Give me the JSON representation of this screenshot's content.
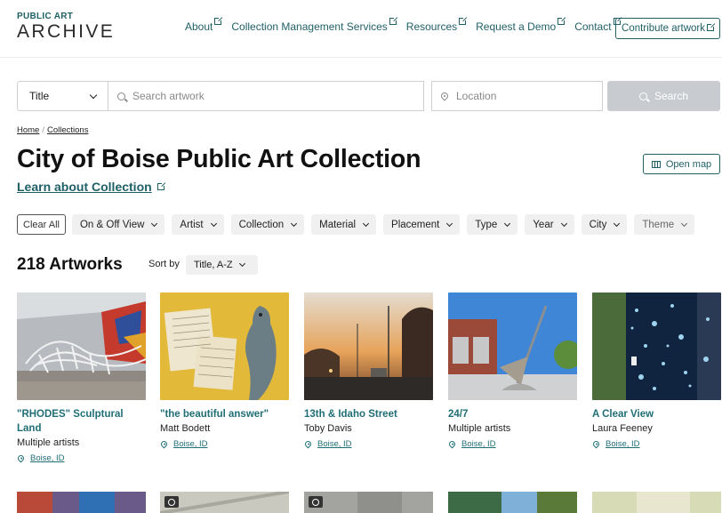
{
  "header": {
    "logo_top": "PUBLIC ART",
    "logo_bottom": "ARCHIVE",
    "nav": [
      "About",
      "Collection Management Services",
      "Resources",
      "Request a Demo",
      "Contact"
    ],
    "contribute_label": "Contribute artwork"
  },
  "search": {
    "field_select": "Title",
    "search_placeholder": "Search artwork",
    "location_placeholder": "Location",
    "button_label": "Search"
  },
  "breadcrumb": {
    "home": "Home",
    "separator": "/",
    "current": "Collections"
  },
  "page": {
    "title": "City of Boise Public Art Collection",
    "learn_more": "Learn about Collection",
    "open_map": "Open map"
  },
  "filters": {
    "clear_all": "Clear All",
    "chips": [
      "On & Off View",
      "Artist",
      "Collection",
      "Material",
      "Placement",
      "Type",
      "Year",
      "City",
      "Theme"
    ]
  },
  "results": {
    "count_label": "218 Artworks",
    "sort_label": "Sort by",
    "sort_value": "Title, A-Z"
  },
  "artworks": [
    {
      "title": "\"RHODES\" Sculptural Land",
      "artist": "Multiple artists",
      "location": "Boise, ID"
    },
    {
      "title": "\"the beautiful answer\"",
      "artist": "Matt Bodett",
      "location": "Boise, ID"
    },
    {
      "title": "13th & Idaho Street",
      "artist": "Toby Davis",
      "location": "Boise, ID"
    },
    {
      "title": "24/7",
      "artist": "Multiple artists",
      "location": "Boise, ID"
    },
    {
      "title": "A Clear View",
      "artist": "Laura Feeney",
      "location": "Boise, ID"
    }
  ],
  "colors": {
    "accent": "#1f5f66",
    "link": "#1f6e76",
    "search_button": "#c8cbcf"
  }
}
